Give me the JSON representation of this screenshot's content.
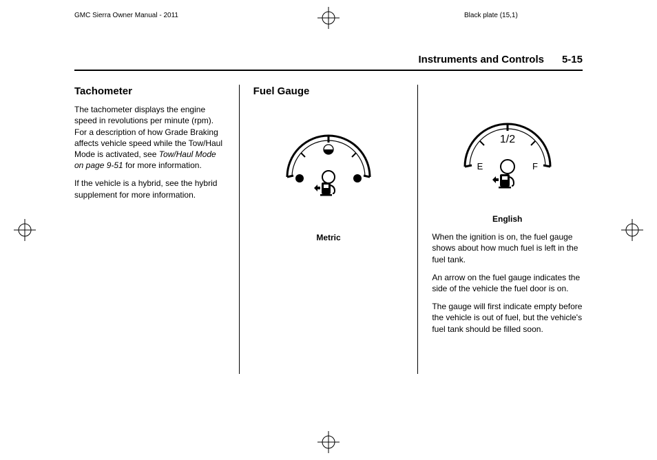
{
  "print": {
    "left_header": "GMC Sierra Owner Manual - 2011",
    "right_header": "Black plate (15,1)"
  },
  "header": {
    "section_title": "Instruments and Controls",
    "page_number": "5-15"
  },
  "col1": {
    "heading": "Tachometer",
    "p1_a": "The tachometer displays the engine speed in revolutions per minute (rpm). For a description of how Grade Braking affects vehicle speed while the Tow/Haul Mode is activated, see ",
    "p1_italic": "Tow/Haul Mode on page 9-51",
    "p1_b": " for more information.",
    "p2": "If the vehicle is a hybrid, see the hybrid supplement for more information."
  },
  "col2": {
    "heading": "Fuel Gauge",
    "fig_caption": "Metric"
  },
  "col3": {
    "fig_caption": "English",
    "gauge_half": "1/2",
    "gauge_e": "E",
    "gauge_f": "F",
    "p1": "When the ignition is on, the fuel gauge shows about how much fuel is left in the fuel tank.",
    "p2": "An arrow on the fuel gauge indicates the side of the vehicle the fuel door is on.",
    "p3": "The gauge will first indicate empty before the vehicle is out of fuel, but the vehicle's fuel tank should be filled soon."
  }
}
